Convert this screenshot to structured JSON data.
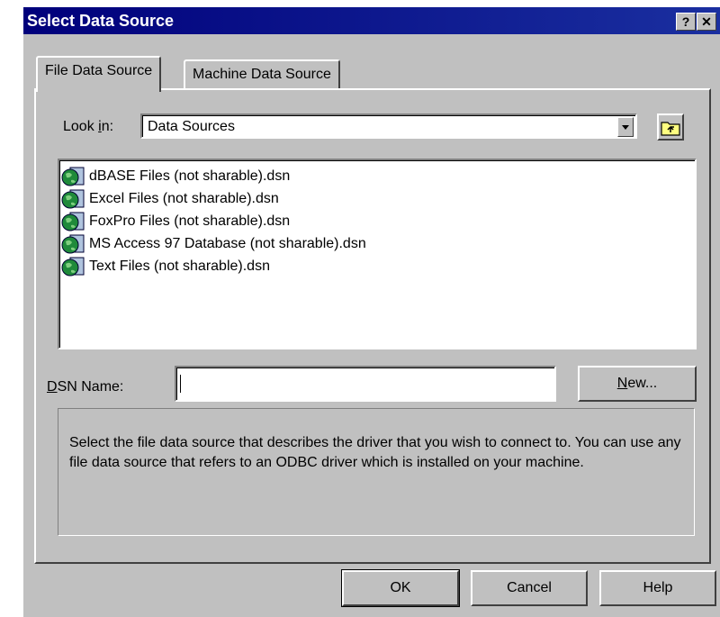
{
  "window": {
    "title": "Select Data Source",
    "help_label": "?",
    "close_label": "✕"
  },
  "tabs": [
    {
      "label": "File Data Source",
      "active": true
    },
    {
      "label": "Machine Data Source",
      "active": false
    }
  ],
  "look_in": {
    "label_pre": "Look ",
    "label_key": "i",
    "label_post": "n:",
    "value": "Data Sources",
    "up_folder_icon": "up-one-level-folder-icon"
  },
  "files": [
    {
      "name": "dBASE Files (not sharable).dsn",
      "icon": "data-source-globe-icon"
    },
    {
      "name": "Excel Files (not sharable).dsn",
      "icon": "data-source-globe-icon"
    },
    {
      "name": "FoxPro Files (not sharable).dsn",
      "icon": "data-source-globe-icon"
    },
    {
      "name": "MS Access 97 Database (not sharable).dsn",
      "icon": "data-source-globe-icon"
    },
    {
      "name": "Text Files (not sharable).dsn",
      "icon": "data-source-globe-icon"
    }
  ],
  "dsn_name": {
    "label_key": "D",
    "label_rest": "SN Name:",
    "value": ""
  },
  "new_button": {
    "key": "N",
    "rest": "ew..."
  },
  "info_text": "Select the file data source that describes the driver that you wish to connect to. You can use any file data source that refers to an ODBC driver which is installed on your machine.",
  "buttons": {
    "ok": "OK",
    "cancel": "Cancel",
    "help": "Help"
  },
  "colors": {
    "titlebar": "#00007b",
    "face": "#c0c0c0",
    "globe": "#1f8a3a"
  }
}
